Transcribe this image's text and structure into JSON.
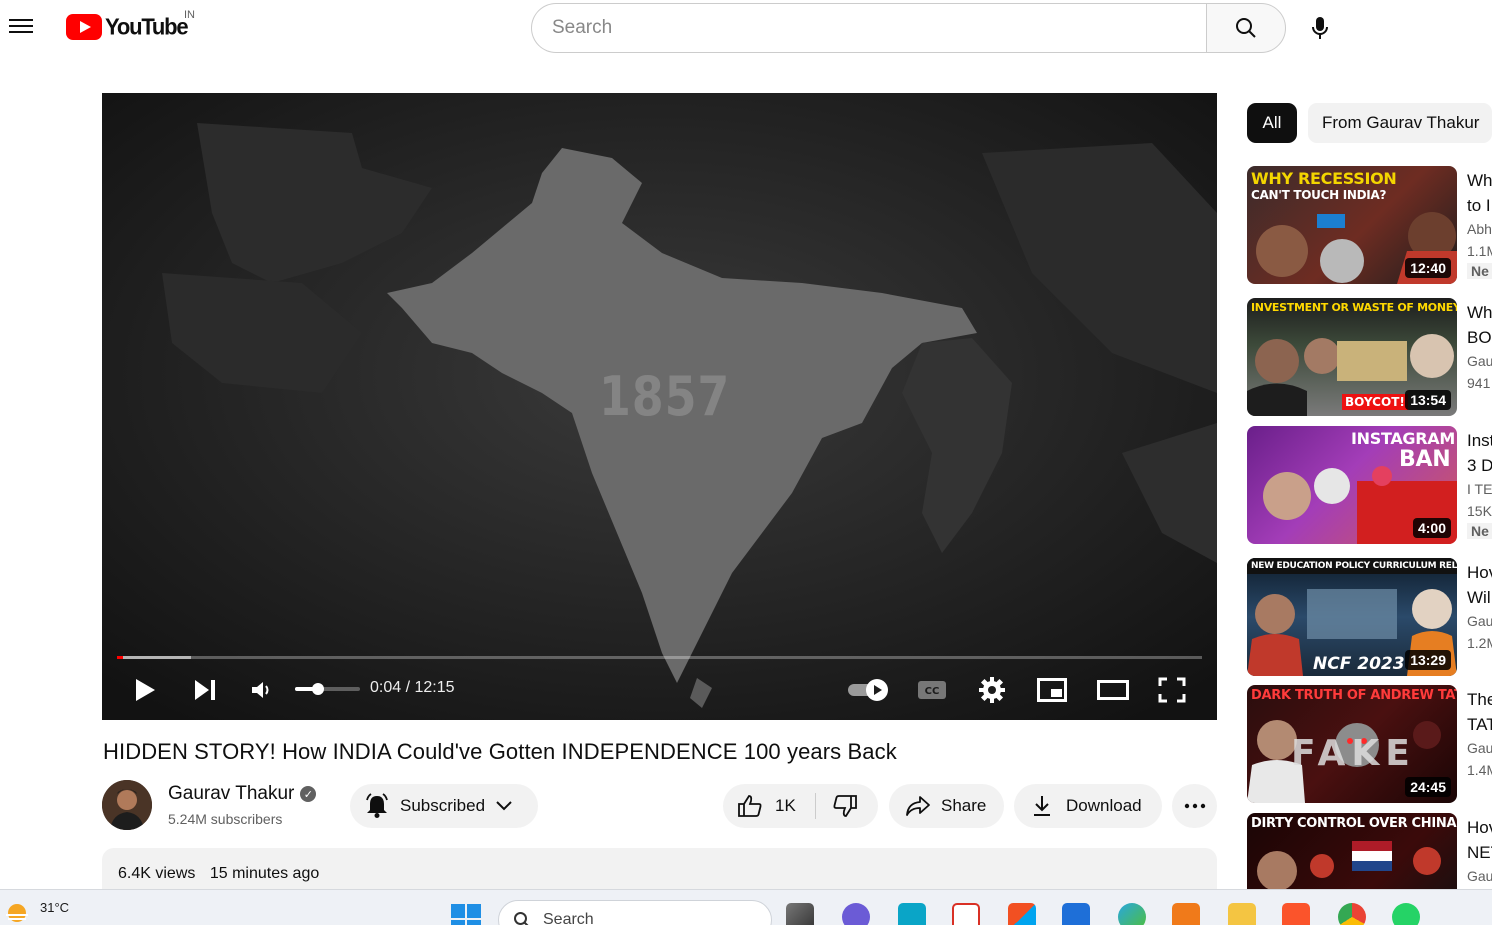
{
  "header": {
    "logo_text": "YouTube",
    "country_code": "IN",
    "search_placeholder": "Search"
  },
  "player": {
    "overlay_year": "1857",
    "current_time": "0:04",
    "separator": "/",
    "total_time": "12:15",
    "progress_played_fraction": 0.005,
    "progress_buffered_fraction": 0.068,
    "volume_fraction": 0.36
  },
  "video": {
    "title": "HIDDEN STORY! How INDIA Could've Gotten INDEPENDENCE 100 years Back",
    "channel_name": "Gaurav Thakur",
    "subscribers": "5.24M subscribers",
    "subscribe_label": "Subscribed",
    "like_count": "1K",
    "share_label": "Share",
    "download_label": "Download",
    "views": "6.4K views",
    "posted": "15 minutes ago"
  },
  "sidebar": {
    "chips": [
      "All",
      "From Gaurav Thakur"
    ],
    "recommendations": [
      {
        "headline_1": "WHY RECESSION",
        "headline_2": "CAN'T TOUCH INDIA?",
        "duration": "12:40",
        "title_1": "Wh",
        "title_2": "to I",
        "meta_1": "Abh",
        "meta_2": "1.1M",
        "badge": "Ne"
      },
      {
        "headline_1": "INVESTMENT OR WASTE OF MONEY",
        "headline_2": "BOYCOT!",
        "duration": "13:54",
        "title_1": "Wh",
        "title_2": "BO",
        "meta_1": "Gau",
        "meta_2": "941",
        "badge": ""
      },
      {
        "headline_1": "INSTAGRAM",
        "headline_2": "BAN",
        "duration": "4:00",
        "title_1": "Inst",
        "title_2": "3 D",
        "meta_1": "I TE",
        "meta_2": "15K",
        "badge": "Ne"
      },
      {
        "headline_1": "NEW EDUCATION POLICY CURRICULUM RELEASED",
        "headline_2": "NCF 2023",
        "duration": "13:29",
        "title_1": "Hov",
        "title_2": "Wil",
        "meta_1": "Gau",
        "meta_2": "1.2M",
        "badge": ""
      },
      {
        "headline_1": "DARK TRUTH OF ANDREW TATE",
        "headline_2": "FAKE",
        "duration": "24:45",
        "title_1": "The",
        "title_2": "TAT",
        "meta_1": "Gau",
        "meta_2": "1.4M",
        "badge": ""
      },
      {
        "headline_1": "DIRTY CONTROL OVER CHINA",
        "headline_2": "",
        "duration": "",
        "title_1": "Hov",
        "title_2": "NET",
        "meta_1": "Gau",
        "meta_2": "",
        "badge": ""
      }
    ]
  },
  "taskbar": {
    "temperature": "31°C",
    "search_label": "Search",
    "apps": [
      "file-explorer",
      "brave",
      "chrome",
      "whatsapp"
    ]
  },
  "colors": {
    "brand_red": "#ff0000",
    "player_bg": "#1c1c1c",
    "chip_active": "#0f0f0f",
    "pill_bg": "#f2f2f2"
  }
}
